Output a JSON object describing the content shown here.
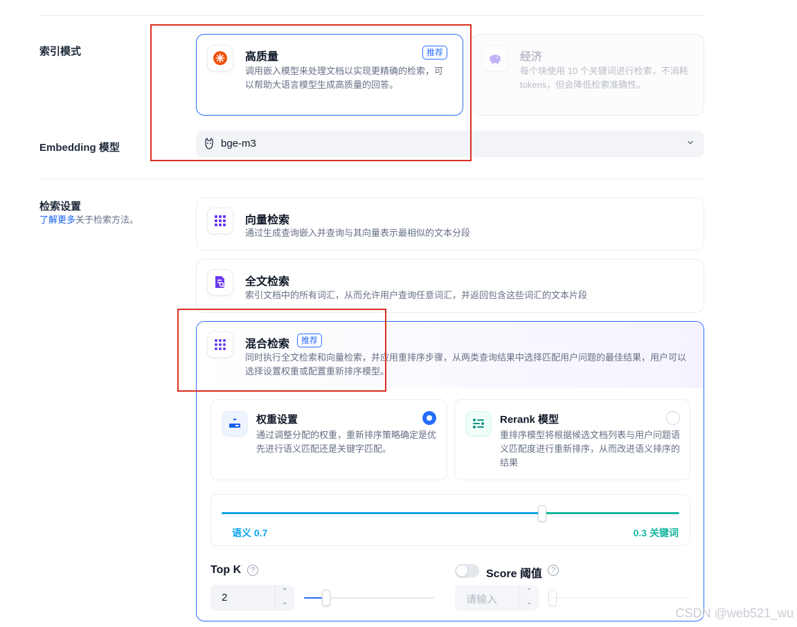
{
  "index_mode": {
    "label": "索引模式",
    "high_quality": {
      "title": "高质量",
      "badge": "推荐",
      "desc": "调用嵌入模型来处理文档以实现更精确的检索，可以帮助大语言模型生成高质量的回答。"
    },
    "economy": {
      "title": "经济",
      "desc": "每个块使用 10 个关键词进行检索，不消耗 tokens，但会降低检索准确性。"
    }
  },
  "embedding": {
    "label": "Embedding 模型",
    "model": "bge-m3"
  },
  "retrieval": {
    "label": "检索设置",
    "learn_more": "了解更多",
    "learn_more_suffix": "关于检索方法。",
    "vector": {
      "title": "向量检索",
      "desc": "通过生成查询嵌入并查询与其向量表示最相似的文本分段"
    },
    "fulltext": {
      "title": "全文检索",
      "desc": "索引文档中的所有词汇，从而允许用户查询任意词汇，并返回包含这些词汇的文本片段"
    },
    "hybrid": {
      "title": "混合检索",
      "badge": "推荐",
      "desc": "同时执行全文检索和向量检索，并应用重排序步骤，从两类查询结果中选择匹配用户问题的最佳结果，用户可以选择设置权重或配置重新排序模型。",
      "weight": {
        "title": "权重设置",
        "desc": "通过调整分配的权重，重新排序策略确定是优先进行语义匹配还是关键字匹配。",
        "selected": true
      },
      "rerank": {
        "title": "Rerank 模型",
        "desc": "重排序模型将根据候选文档列表与用户问题语义匹配度进行重新排序，从而改进语义排序的结果",
        "selected": false
      },
      "slider": {
        "semantic_label": "语义 0.7",
        "keyword_label": "0.3 关键词",
        "semantic_weight": 0.7,
        "semantic_color": "#0ba5ec",
        "keyword_color": "#15b79e"
      },
      "top_k": {
        "label": "Top K",
        "value": "2",
        "help": "?",
        "slider_fraction": 0.17
      },
      "score": {
        "label": "Score 阈值",
        "placeholder": "请输入",
        "help": "?",
        "enabled": false
      }
    }
  },
  "watermark": "CSDN @web521_wu"
}
